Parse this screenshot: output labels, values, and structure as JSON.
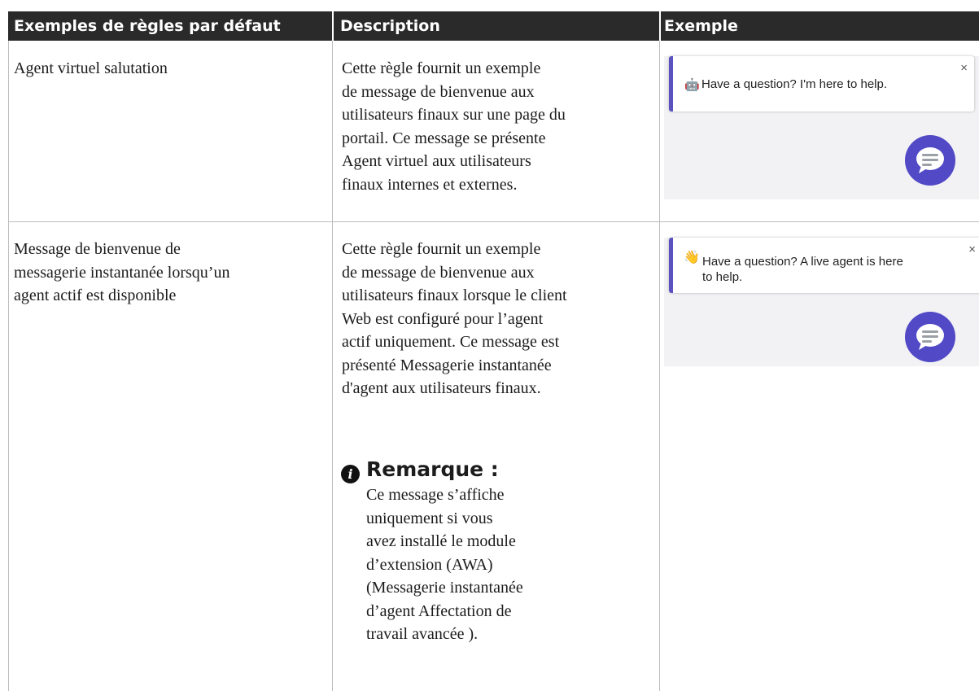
{
  "table": {
    "headers": [
      "Exemples de règles par défaut",
      "Description",
      "Exemple"
    ],
    "rows": [
      {
        "rule": [
          "Agent virtuel salutation"
        ],
        "description": [
          "Cette règle fournit un exemple",
          "de message de bienvenue aux",
          "utilisateurs finaux sur une page du",
          "portail. Ce message se présente",
          "Agent virtuel aux utilisateurs",
          "finaux internes et externes."
        ],
        "example": {
          "icon": "robot-emoji-icon",
          "message_lines": [
            "Have a question? I'm here to help."
          ],
          "close": "×"
        }
      },
      {
        "rule": [
          "Message de bienvenue de",
          "messagerie instantanée lorsqu’un",
          "agent actif est disponible"
        ],
        "description": [
          "Cette règle fournit un exemple",
          "de message de bienvenue aux",
          "utilisateurs finaux lorsque le client",
          "Web est configuré pour l’agent",
          "actif uniquement. Ce message est",
          "présenté Messagerie instantanée",
          "d'agent aux utilisateurs finaux."
        ],
        "note": {
          "icon": "info-icon",
          "title": "Remarque :",
          "lines": [
            "Ce message s’affiche",
            "uniquement si vous",
            "avez installé le module",
            "d’extension (AWA)",
            "(Messagerie instantanée",
            "d’agent Affectation de",
            "travail avancée )."
          ]
        },
        "example": {
          "icon": "waving-hand-icon",
          "message_lines": [
            "Have a question? A live agent is here",
            "to help."
          ],
          "close": "×"
        }
      }
    ]
  },
  "colors": {
    "header_bg": "#2a2a2a",
    "accent": "#5b52c0",
    "chat_button": "#5149c6",
    "panel_bg": "#f2f2f4"
  }
}
